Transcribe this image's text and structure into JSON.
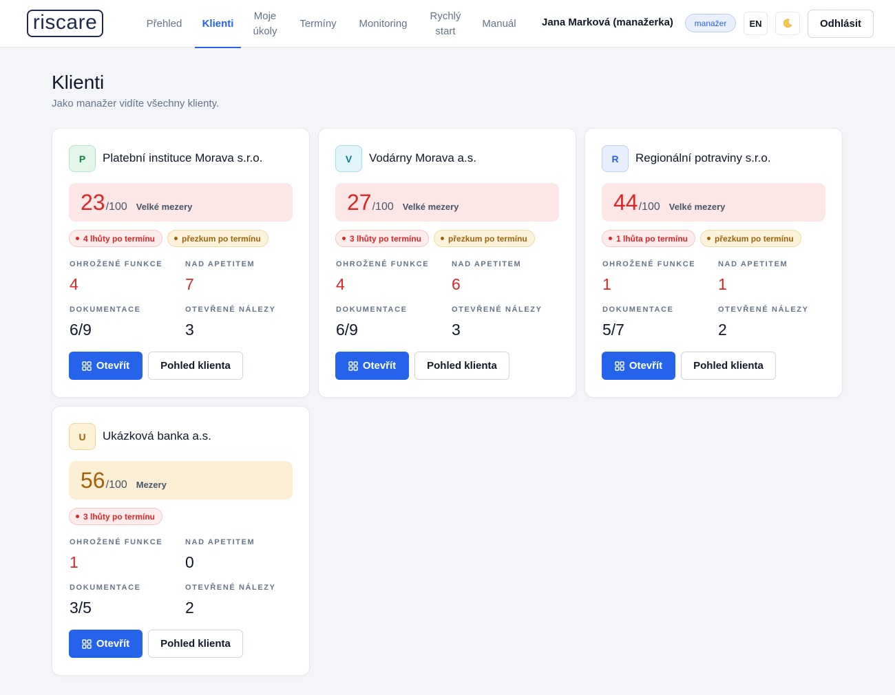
{
  "app": {
    "logo_text": "riscare"
  },
  "nav": [
    {
      "label": "Přehled",
      "active": false
    },
    {
      "label": "Klienti",
      "active": true
    },
    {
      "label": "Moje úkoly",
      "active": false
    },
    {
      "label": "Termíny",
      "active": false
    },
    {
      "label": "Monitoring",
      "active": false
    },
    {
      "label": "Rychlý start",
      "active": false
    },
    {
      "label": "Manuál",
      "active": false
    }
  ],
  "user": {
    "name": "Jana Marková (manažerka)",
    "role_badge": "manažer",
    "lang_button": "EN",
    "theme_icon": "moon-icon",
    "logout_label": "Odhlásit"
  },
  "page": {
    "title": "Klienti",
    "subtitle": "Jako manažer vidíte všechny klienty."
  },
  "labels": {
    "threatened_functions": "OHROŽENÉ FUNKCE",
    "over_appetite": "NAD APETITEM",
    "documentation": "DOKUMENTACE",
    "open_findings": "OTEVŘENÉ NÁLEZY",
    "open_button": "Otevřít",
    "client_view_button": "Pohled klienta",
    "score_max": "/100"
  },
  "colors": {
    "accent": "#2563eb",
    "danger": "#dc2626",
    "warning": "#a16207"
  },
  "clients": [
    {
      "initial": "P",
      "avatar_bg": "#e3f6ea",
      "avatar_border": "#b7e4c7",
      "avatar_fg": "#15803d",
      "name": "Platební instituce Morava s.r.o.",
      "score": "23",
      "score_label": "Velké mezery",
      "score_level": "red",
      "chips": [
        {
          "text": "4 lhůty po termínu",
          "tone": "red"
        },
        {
          "text": "přezkum po termínu",
          "tone": "amber"
        }
      ],
      "threatened_functions": "4",
      "threatened_red": true,
      "over_appetite": "7",
      "over_red": true,
      "documentation": "6/9",
      "open_findings": "3"
    },
    {
      "initial": "V",
      "avatar_bg": "#e0f4f9",
      "avatar_border": "#a9dbe9",
      "avatar_fg": "#0e7490",
      "name": "Vodárny Morava a.s.",
      "score": "27",
      "score_label": "Velké mezery",
      "score_level": "red",
      "chips": [
        {
          "text": "3 lhůty po termínu",
          "tone": "red"
        },
        {
          "text": "přezkum po termínu",
          "tone": "amber"
        }
      ],
      "threatened_functions": "4",
      "threatened_red": true,
      "over_appetite": "6",
      "over_red": true,
      "documentation": "6/9",
      "open_findings": "3"
    },
    {
      "initial": "R",
      "avatar_bg": "#e8effc",
      "avatar_border": "#bcd0f3",
      "avatar_fg": "#2563eb",
      "name": "Regionální potraviny s.r.o.",
      "score": "44",
      "score_label": "Velké mezery",
      "score_level": "red",
      "chips": [
        {
          "text": "1 lhůta po termínu",
          "tone": "red"
        },
        {
          "text": "přezkum po termínu",
          "tone": "amber"
        }
      ],
      "threatened_functions": "1",
      "threatened_red": true,
      "over_appetite": "1",
      "over_red": true,
      "documentation": "5/7",
      "open_findings": "2"
    },
    {
      "initial": "U",
      "avatar_bg": "#fdf1d8",
      "avatar_border": "#f1d49a",
      "avatar_fg": "#a16207",
      "name": "Ukázková banka a.s.",
      "score": "56",
      "score_label": "Mezery",
      "score_level": "amber",
      "chips": [
        {
          "text": "3 lhůty po termínu",
          "tone": "red"
        }
      ],
      "threatened_functions": "1",
      "threatened_red": true,
      "over_appetite": "0",
      "over_red": false,
      "documentation": "3/5",
      "open_findings": "2"
    }
  ]
}
